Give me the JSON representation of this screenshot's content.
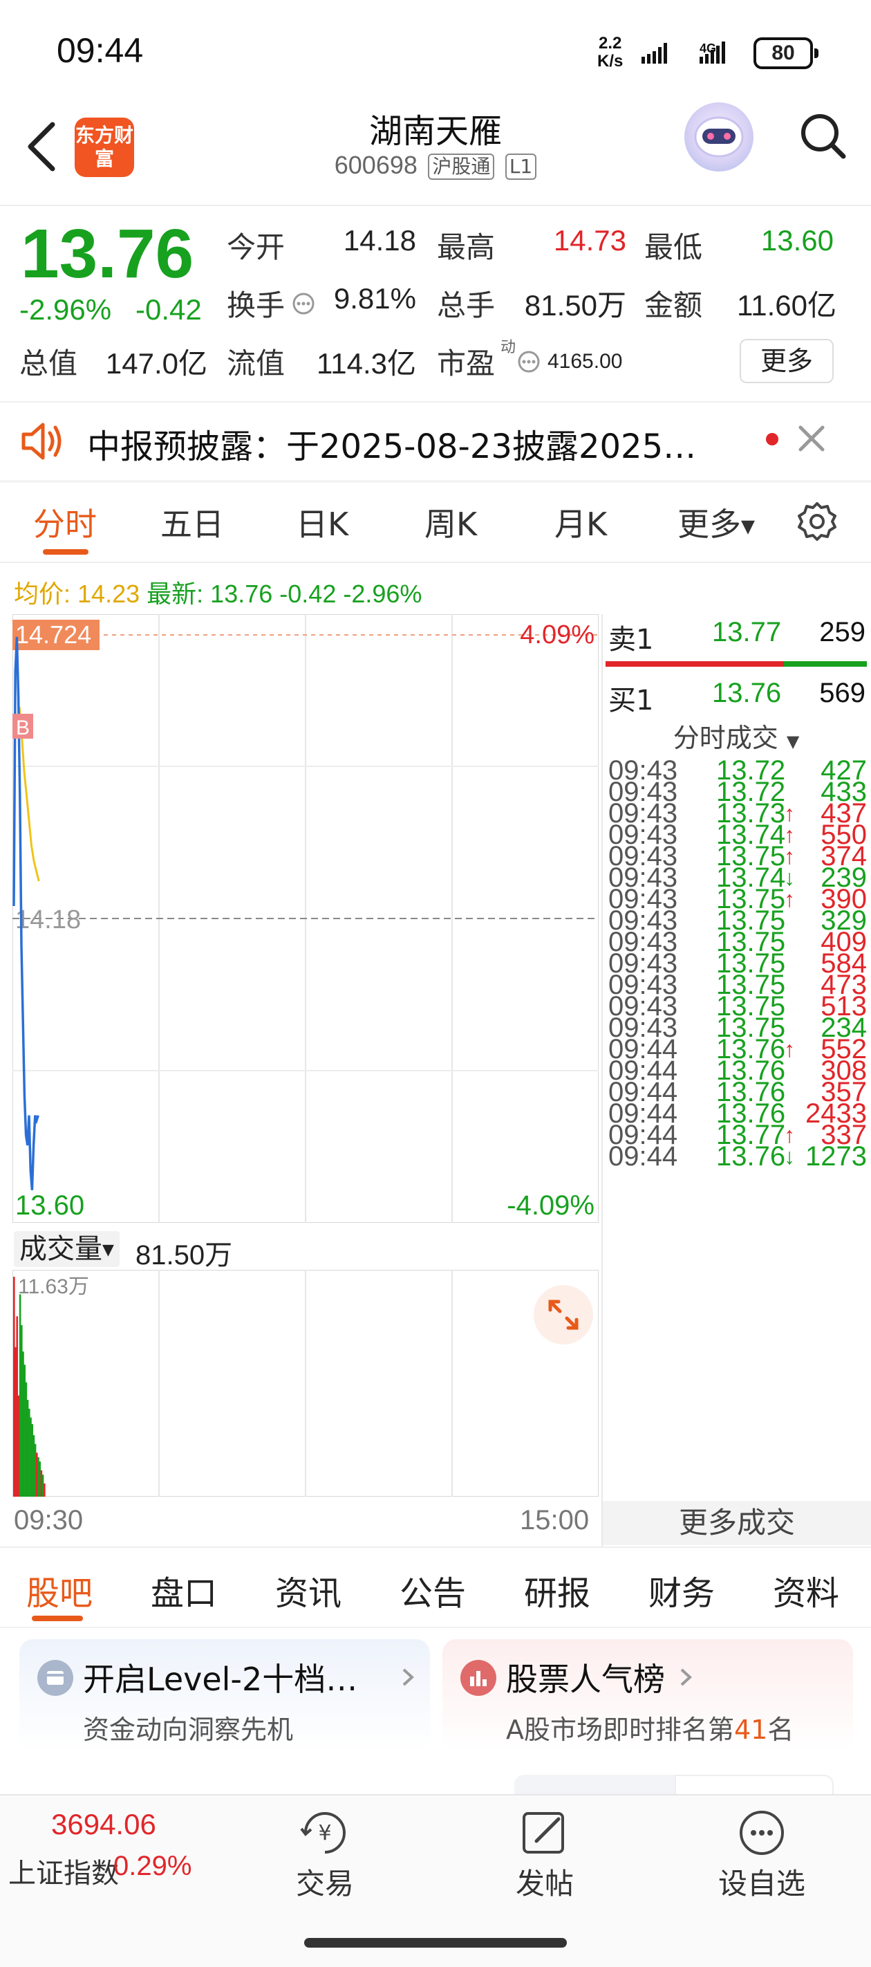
{
  "status_bar": {
    "time": "09:44",
    "net_speed_value": "2.2",
    "net_speed_unit": "K/s",
    "network_type": "4G",
    "battery": "80"
  },
  "header": {
    "brand_logo_text": "东方财富",
    "stock_name": "湖南天雁",
    "stock_code": "600698",
    "tag_connect": "沪股通",
    "tag_level": "L1"
  },
  "quote": {
    "price": "13.76",
    "change_pct": "-2.96%",
    "change_abs": "-0.42",
    "open_label": "今开",
    "open_value": "14.18",
    "high_label": "最高",
    "high_value": "14.73",
    "low_label": "最低",
    "low_value": "13.60",
    "turnover_label": "换手",
    "turnover_value": "9.81%",
    "volume_label": "总手",
    "volume_value": "81.50万",
    "amount_label": "金额",
    "amount_value": "11.60亿",
    "mcap_label": "总值",
    "mcap_value": "147.0亿",
    "float_label": "流值",
    "float_value": "114.3亿",
    "pe_label": "市盈",
    "pe_superscript": "动",
    "pe_value": "4165.00",
    "more_label": "更多"
  },
  "notice": {
    "text": "中报预披露：于2025-08-23披露2025…"
  },
  "chart_tabs": {
    "items": [
      "分时",
      "五日",
      "日K",
      "周K",
      "月K",
      "更多"
    ]
  },
  "avg_line": {
    "avg_label": "均价:",
    "avg_value": "14.23",
    "latest_label": "最新:",
    "latest_value": "13.76",
    "latest_change": "-0.42",
    "latest_pct": "-2.96%"
  },
  "price_chart": {
    "high_label": "14.724",
    "high_pct": "4.09%",
    "base_label": "14.18",
    "low_label": "13.60",
    "low_pct": "-4.09%",
    "buy_marker": "B"
  },
  "volume_chart": {
    "selector_label": "成交量",
    "total": "81.50万",
    "max_label": "11.63万",
    "time_start": "09:30",
    "time_end": "15:00"
  },
  "chart_data": {
    "type": "line",
    "x_range": [
      "09:30",
      "15:00"
    ],
    "ylim": [
      13.6,
      14.724
    ],
    "base_price": 14.18,
    "series": [
      {
        "values": [
          14.18,
          14.65,
          14.72,
          14.6,
          14.4,
          14.1,
          13.95,
          13.8,
          13.72,
          13.7,
          13.76,
          13.65,
          13.61,
          13.7,
          13.76,
          13.75,
          13.76
        ]
      },
      {
        "values": [
          14.58,
          14.52,
          14.45,
          14.4,
          14.35,
          14.3,
          14.27,
          14.25,
          14.23
        ]
      }
    ],
    "volume_bars": [
      {
        "color": "red",
        "value": 1.0
      },
      {
        "color": "red",
        "value": 0.68
      },
      {
        "color": "red",
        "value": 0.82
      },
      {
        "color": "red",
        "value": 0.46
      },
      {
        "color": "green",
        "value": 0.92
      },
      {
        "color": "green",
        "value": 0.78
      },
      {
        "color": "green",
        "value": 0.66
      },
      {
        "color": "green",
        "value": 0.6
      },
      {
        "color": "green",
        "value": 0.52
      },
      {
        "color": "green",
        "value": 0.44
      },
      {
        "color": "green",
        "value": 0.4
      },
      {
        "color": "green",
        "value": 0.36
      },
      {
        "color": "green",
        "value": 0.33
      },
      {
        "color": "green",
        "value": 0.28
      },
      {
        "color": "green",
        "value": 0.24
      },
      {
        "color": "red",
        "value": 0.2
      },
      {
        "color": "green",
        "value": 0.18
      },
      {
        "color": "green",
        "value": 0.16
      },
      {
        "color": "red",
        "value": 0.12
      },
      {
        "color": "green",
        "value": 0.1
      },
      {
        "color": "red",
        "value": 0.06
      }
    ]
  },
  "order_book": {
    "sell1_label": "卖1",
    "sell1_price": "13.77",
    "sell1_vol": "259",
    "buy1_label": "买1",
    "buy1_price": "13.76",
    "buy1_vol": "569",
    "trades_header": "分时成交"
  },
  "trades": [
    {
      "time": "09:43",
      "price": "13.72",
      "arrow": "",
      "vol": "427",
      "vol_color": "green"
    },
    {
      "time": "09:43",
      "price": "13.72",
      "arrow": "",
      "vol": "433",
      "vol_color": "green"
    },
    {
      "time": "09:43",
      "price": "13.73",
      "arrow": "↑",
      "vol": "437",
      "vol_color": "red"
    },
    {
      "time": "09:43",
      "price": "13.74",
      "arrow": "↑",
      "vol": "550",
      "vol_color": "red"
    },
    {
      "time": "09:43",
      "price": "13.75",
      "arrow": "↑",
      "vol": "374",
      "vol_color": "red"
    },
    {
      "time": "09:43",
      "price": "13.74",
      "arrow": "↓",
      "vol": "239",
      "vol_color": "green"
    },
    {
      "time": "09:43",
      "price": "13.75",
      "arrow": "↑",
      "vol": "390",
      "vol_color": "red"
    },
    {
      "time": "09:43",
      "price": "13.75",
      "arrow": "",
      "vol": "329",
      "vol_color": "green"
    },
    {
      "time": "09:43",
      "price": "13.75",
      "arrow": "",
      "vol": "409",
      "vol_color": "red"
    },
    {
      "time": "09:43",
      "price": "13.75",
      "arrow": "",
      "vol": "584",
      "vol_color": "red"
    },
    {
      "time": "09:43",
      "price": "13.75",
      "arrow": "",
      "vol": "473",
      "vol_color": "red"
    },
    {
      "time": "09:43",
      "price": "13.75",
      "arrow": "",
      "vol": "513",
      "vol_color": "red"
    },
    {
      "time": "09:43",
      "price": "13.75",
      "arrow": "",
      "vol": "234",
      "vol_color": "green"
    },
    {
      "time": "09:44",
      "price": "13.76",
      "arrow": "↑",
      "vol": "552",
      "vol_color": "red"
    },
    {
      "time": "09:44",
      "price": "13.76",
      "arrow": "",
      "vol": "308",
      "vol_color": "red"
    },
    {
      "time": "09:44",
      "price": "13.76",
      "arrow": "",
      "vol": "357",
      "vol_color": "red"
    },
    {
      "time": "09:44",
      "price": "13.76",
      "arrow": "",
      "vol": "2433",
      "vol_color": "red"
    },
    {
      "time": "09:44",
      "price": "13.77",
      "arrow": "↑",
      "vol": "337",
      "vol_color": "red"
    },
    {
      "time": "09:44",
      "price": "13.76",
      "arrow": "↓",
      "vol": "1273",
      "vol_color": "green"
    }
  ],
  "more_trades_label": "更多成交",
  "bottom_tabs": {
    "items": [
      "股吧",
      "盘口",
      "资讯",
      "公告",
      "研报",
      "财务",
      "资料"
    ]
  },
  "cards": {
    "level2_title": "开启Level-2十档…",
    "level2_sub": "资金动向洞察先机",
    "rank_title": "股票人气榜",
    "rank_sub_prefix": "A股市场即时排名第",
    "rank_number": "41",
    "rank_sub_suffix": "名"
  },
  "bottom_nav": {
    "index_value": "3694.06",
    "index_name": "上证指数",
    "index_pct": "0.29%",
    "trade_label": "交易",
    "post_label": "发帖",
    "watchlist_label": "设自选"
  },
  "colors": {
    "up": "#e1262a",
    "down": "#17a11f",
    "accent": "#e85a1a",
    "price_line": "#2a6fd6",
    "avg_line": "#f0c419"
  }
}
